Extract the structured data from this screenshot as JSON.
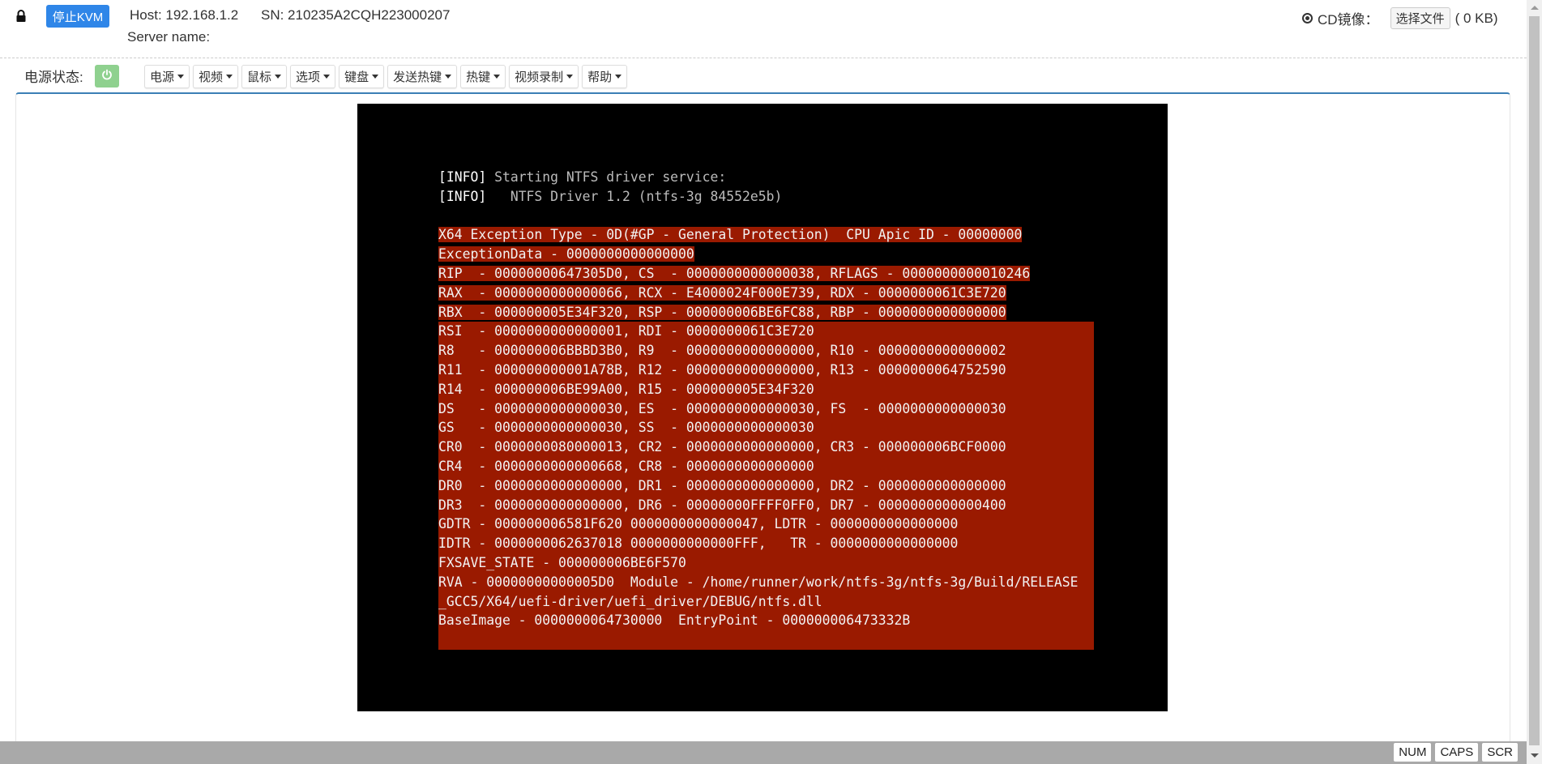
{
  "header": {
    "stop_kvm_label": "停止KVM",
    "host": "Host: 192.168.1.2",
    "sn": "SN: 210235A2CQH223000207",
    "server_name": "Server name:",
    "cd_label": "CD镜像：",
    "choose_file_label": "选择文件",
    "file_size": "( 0 KB)"
  },
  "toolbar": {
    "power_status_label": "电源状态:",
    "power_icon": "power-icon",
    "menus": [
      "电源",
      "视频",
      "鼠标",
      "选项",
      "键盘",
      "发送热键",
      "热键",
      "视频录制",
      "帮助"
    ]
  },
  "console": {
    "info_lines": [
      {
        "tag": "[INFO]",
        "text": " Starting NTFS driver service:"
      },
      {
        "tag": "[INFO]",
        "text": "   NTFS Driver 1.2 (ntfs-3g 84552e5b)"
      }
    ],
    "exception_lines": [
      "X64 Exception Type - 0D(#GP - General Protection)  CPU Apic ID - 00000000",
      "ExceptionData - 0000000000000000",
      "RIP  - 00000000647305D0, CS  - 0000000000000038, RFLAGS - 0000000000010246",
      "RAX  - 0000000000000066, RCX - E4000024F000E739, RDX - 0000000061C3E720",
      "RBX  - 000000005E34F320, RSP - 000000006BE6FC88, RBP - 0000000000000000"
    ],
    "block_lines": [
      "RSI  - 0000000000000001, RDI - 0000000061C3E720",
      "R8   - 000000006BBBD3B0, R9  - 0000000000000000, R10 - 0000000000000002",
      "R11  - 000000000001A78B, R12 - 0000000000000000, R13 - 0000000064752590",
      "R14  - 000000006BE99A00, R15 - 000000005E34F320",
      "DS   - 0000000000000030, ES  - 0000000000000030, FS  - 0000000000000030",
      "GS   - 0000000000000030, SS  - 0000000000000030",
      "CR0  - 0000000080000013, CR2 - 0000000000000000, CR3 - 000000006BCF0000",
      "CR4  - 0000000000000668, CR8 - 0000000000000000",
      "DR0  - 0000000000000000, DR1 - 0000000000000000, DR2 - 0000000000000000",
      "DR3  - 0000000000000000, DR6 - 00000000FFFF0FF0, DR7 - 0000000000000400",
      "GDTR - 000000006581F620 0000000000000047, LDTR - 0000000000000000",
      "IDTR - 0000000062637018 0000000000000FFF,   TR - 0000000000000000",
      "FXSAVE_STATE - 000000006BE6F570",
      "RVA - 00000000000005D0  Module - /home/runner/work/ntfs-3g/ntfs-3g/Build/RELEASE",
      "_GCC5/X64/uefi-driver/uefi_driver/DEBUG/ntfs.dll",
      "BaseImage - 0000000064730000  EntryPoint - 000000006473332B",
      ""
    ],
    "colors": {
      "background": "#000000",
      "exception_bg": "#9a1a00"
    }
  },
  "statusbar": {
    "keys": [
      "NUM",
      "CAPS",
      "SCR"
    ]
  },
  "colors": {
    "accent": "#2f86e8",
    "power_on": "#8fd18f",
    "panel_border": "#3b7fb5"
  }
}
